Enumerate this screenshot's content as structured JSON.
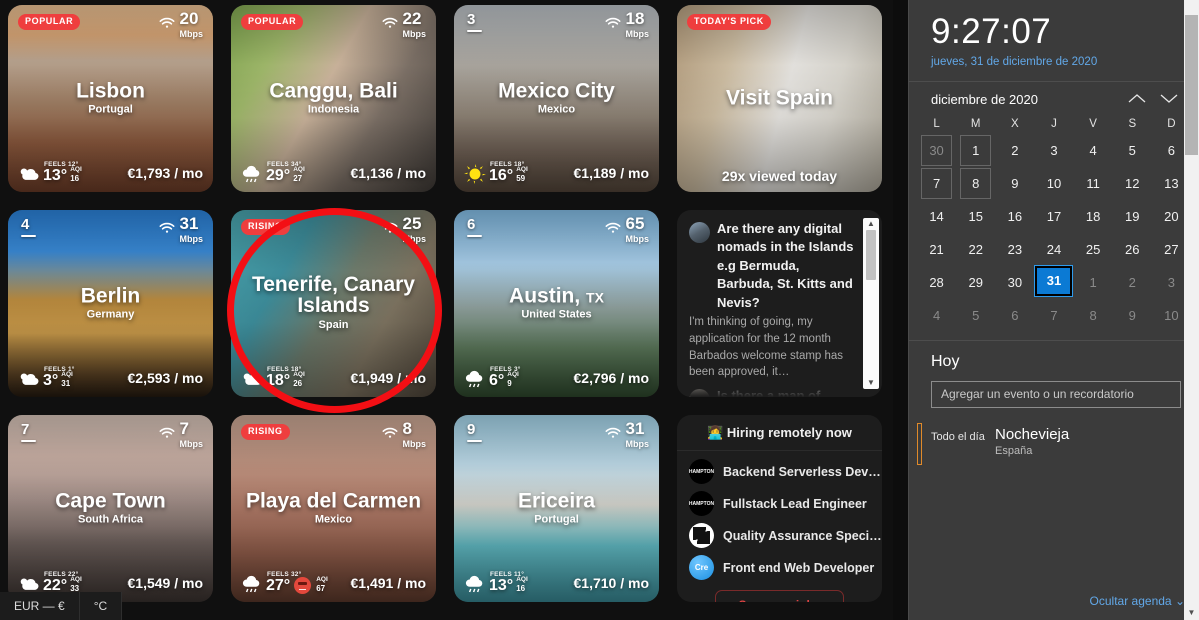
{
  "board": {
    "cards": [
      {
        "type": "city",
        "badge": "POPULAR",
        "rank": null,
        "speed": "20",
        "speed_unit": "Mbps",
        "city": "Lisbon",
        "country": "Portugal",
        "feels": "FEELS 12°",
        "temp": "13°",
        "aqi_label": "AQI",
        "aqi": "16",
        "aqi_bad": false,
        "weather": "cloud-sun-icon",
        "price": "€1,793 / mo"
      },
      {
        "type": "city",
        "badge": "POPULAR",
        "rank": null,
        "speed": "22",
        "speed_unit": "Mbps",
        "city": "Canggu, Bali",
        "country": "Indonesia",
        "feels": "FEELS 34°",
        "temp": "29°",
        "aqi_label": "AQI",
        "aqi": "27",
        "aqi_bad": false,
        "weather": "rain-icon",
        "price": "€1,136 / mo"
      },
      {
        "type": "city",
        "badge": null,
        "rank": "3",
        "speed": "18",
        "speed_unit": "Mbps",
        "city": "Mexico City",
        "country": "Mexico",
        "feels": "FEELS 18°",
        "temp": "16°",
        "aqi_label": "AQI",
        "aqi": "59",
        "aqi_bad": false,
        "weather": "sun-icon",
        "price": "€1,189 / mo"
      },
      {
        "type": "promo",
        "badge": "TODAY'S PICK",
        "title": "Visit Spain",
        "note": "29x viewed today"
      },
      {
        "type": "city",
        "badge": null,
        "rank": "4",
        "speed": "31",
        "speed_unit": "Mbps",
        "city": "Berlin",
        "country": "Germany",
        "feels": "FEELS 1°",
        "temp": "3°",
        "aqi_label": "AQI",
        "aqi": "31",
        "aqi_bad": false,
        "weather": "cloud-sun-icon",
        "price": "€2,593 / mo"
      },
      {
        "type": "city",
        "badge": "RISING",
        "rank": null,
        "speed": "25",
        "speed_unit": "Mbps",
        "city": "Tenerife, Canary Islands",
        "country": "Spain",
        "feels": "FEELS 18°",
        "temp": "18°",
        "aqi_label": "AQI",
        "aqi": "26",
        "aqi_bad": false,
        "weather": "cloud-sun-icon",
        "price": "€1,949 / mo"
      },
      {
        "type": "city",
        "badge": null,
        "rank": "6",
        "speed": "65",
        "speed_unit": "Mbps",
        "city": "Austin, ",
        "city_suffix": "TX",
        "country": "United States",
        "feels": "FEELS 3°",
        "temp": "6°",
        "aqi_label": "AQI",
        "aqi": "9",
        "aqi_bad": false,
        "weather": "rain-icon",
        "price": "€2,796 / mo"
      },
      {
        "type": "forum"
      },
      {
        "type": "city",
        "badge": null,
        "rank": "7",
        "speed": "7",
        "speed_unit": "Mbps",
        "city": "Cape Town",
        "country": "South Africa",
        "feels": "FEELS 22°",
        "temp": "22°",
        "aqi_label": "AQI",
        "aqi": "33",
        "aqi_bad": false,
        "weather": "cloud-sun-icon",
        "price": "€1,549 / mo"
      },
      {
        "type": "city",
        "badge": "RISING",
        "rank": null,
        "speed": "8",
        "speed_unit": "Mbps",
        "city": "Playa del Carmen",
        "country": "Mexico",
        "feels": "FEELS 32°",
        "temp": "27°",
        "aqi_label": "AQI",
        "aqi": "67",
        "aqi_bad": true,
        "weather": "rain-icon",
        "price": "€1,491 / mo"
      },
      {
        "type": "city",
        "badge": null,
        "rank": "9",
        "speed": "31",
        "speed_unit": "Mbps",
        "city": "Ericeira",
        "country": "Portugal",
        "feels": "FEELS 11°",
        "temp": "13°",
        "aqi_label": "AQI",
        "aqi": "16",
        "aqi_bad": false,
        "weather": "rain-icon",
        "price": "€1,710 / mo"
      },
      {
        "type": "hiring"
      }
    ],
    "forum": {
      "threads": [
        {
          "question": "Are there any digital nomads in the Islands e.g Bermuda, Barbuda, St. Kitts and Nevis?",
          "excerpt": "I'm thinking of going, my application for the 12 month Barbados welcome stamp has been approved, it…"
        },
        {
          "question": "Is there a map of",
          "excerpt": ""
        }
      ]
    },
    "hiring": {
      "title": "👩‍💻 Hiring remotely now",
      "jobs": [
        {
          "company_mark": "HAMPTON",
          "title": "Backend Serverless Dev…"
        },
        {
          "company_mark": "HAMPTON",
          "title": "Fullstack Lead Engineer"
        },
        {
          "company_mark": "QA",
          "title": "Quality Assurance Speci…"
        },
        {
          "company_mark": "Cre",
          "title": "Front end Web Developer"
        }
      ],
      "cta": "See more jobs"
    },
    "units": {
      "currency": "EUR — €",
      "temperature": "°C"
    }
  },
  "flyout": {
    "clock": "9:27:07",
    "date": "jueves, 31 de diciembre de 2020",
    "calendar": {
      "month_label": "diciembre de 2020",
      "prev_icon": "chevron-up-icon",
      "next_icon": "chevron-down-icon",
      "weekdays": [
        "L",
        "M",
        "X",
        "J",
        "V",
        "S",
        "D"
      ],
      "weeks": [
        [
          {
            "d": "30",
            "dim": true,
            "box": true
          },
          {
            "d": "1",
            "box": true
          },
          {
            "d": "2"
          },
          {
            "d": "3"
          },
          {
            "d": "4"
          },
          {
            "d": "5"
          },
          {
            "d": "6"
          }
        ],
        [
          {
            "d": "7",
            "box": true
          },
          {
            "d": "8",
            "box": true
          },
          {
            "d": "9"
          },
          {
            "d": "10"
          },
          {
            "d": "11"
          },
          {
            "d": "12"
          },
          {
            "d": "13"
          }
        ],
        [
          {
            "d": "14"
          },
          {
            "d": "15"
          },
          {
            "d": "16"
          },
          {
            "d": "17"
          },
          {
            "d": "18"
          },
          {
            "d": "19"
          },
          {
            "d": "20"
          }
        ],
        [
          {
            "d": "21"
          },
          {
            "d": "22"
          },
          {
            "d": "23"
          },
          {
            "d": "24"
          },
          {
            "d": "25"
          },
          {
            "d": "26"
          },
          {
            "d": "27"
          }
        ],
        [
          {
            "d": "28"
          },
          {
            "d": "29"
          },
          {
            "d": "30"
          },
          {
            "d": "31",
            "today": true
          },
          {
            "d": "1",
            "dim": true
          },
          {
            "d": "2",
            "dim": true
          },
          {
            "d": "3",
            "dim": true
          }
        ],
        [
          {
            "d": "4",
            "dim": true
          },
          {
            "d": "5",
            "dim": true
          },
          {
            "d": "6",
            "dim": true
          },
          {
            "d": "7",
            "dim": true
          },
          {
            "d": "8",
            "dim": true
          },
          {
            "d": "9",
            "dim": true
          },
          {
            "d": "10",
            "dim": true
          }
        ]
      ]
    },
    "agenda": {
      "heading": "Hoy",
      "add_placeholder": "Agregar un evento o un recordatorio",
      "event": {
        "when": "Todo el día",
        "title": "Nochevieja",
        "location": "España"
      },
      "hide_link": "Ocultar agenda"
    }
  }
}
